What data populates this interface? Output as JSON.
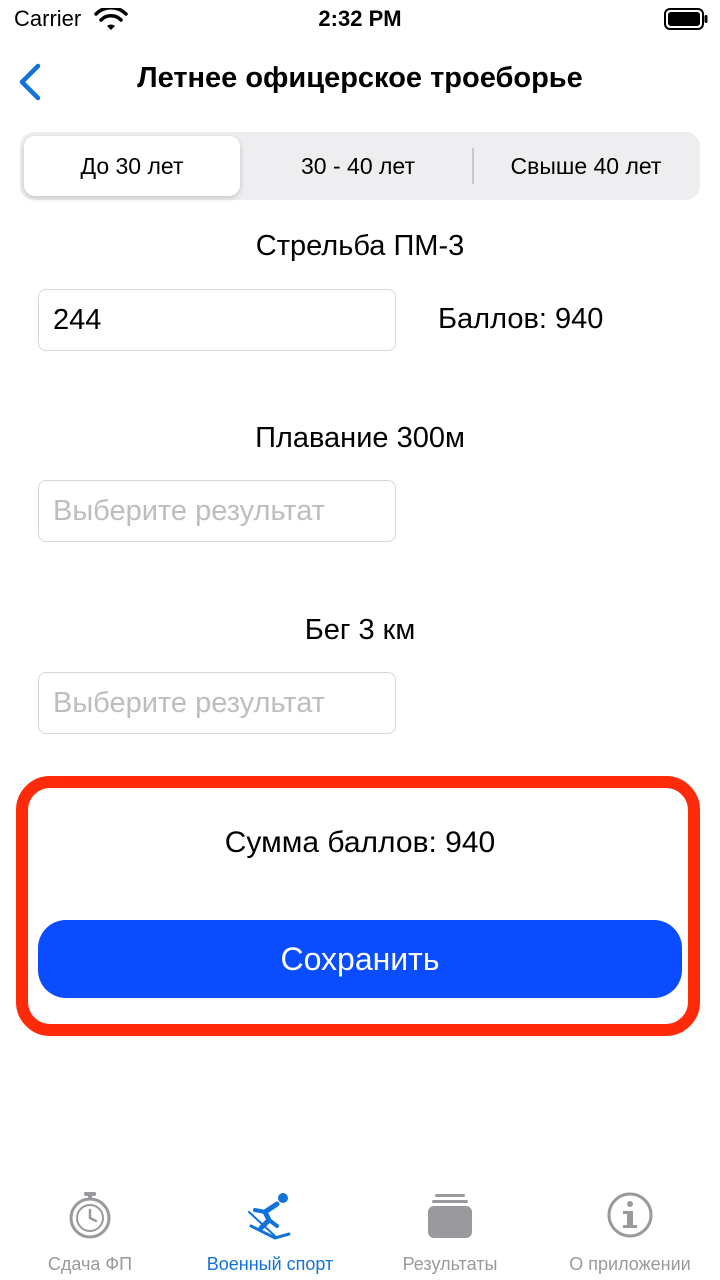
{
  "status_bar": {
    "carrier": "Carrier",
    "time": "2:32 PM"
  },
  "nav": {
    "title": "Летнее офицерское троеборье"
  },
  "segments": [
    {
      "label": "До 30 лет",
      "selected": true
    },
    {
      "label": "30 - 40 лет",
      "selected": false
    },
    {
      "label": "Свыше 40 лет",
      "selected": false
    }
  ],
  "shooting": {
    "label": "Стрельба ПМ-3",
    "value": "244",
    "points": "Баллов: 940"
  },
  "swimming": {
    "label": "Плавание 300м",
    "placeholder": "Выберите результат",
    "value": ""
  },
  "running": {
    "label": "Бег 3 км",
    "placeholder": "Выберите результат",
    "value": ""
  },
  "summary": {
    "total": "Сумма баллов: 940",
    "save_label": "Сохранить",
    "highlight_color": "#ff2a0a"
  },
  "tabs": [
    {
      "label": "Сдача ФП",
      "icon": "stopwatch-icon",
      "active": false
    },
    {
      "label": "Военный спорт",
      "icon": "skier-icon",
      "active": true
    },
    {
      "label": "Результаты",
      "icon": "tray-stack-icon",
      "active": false
    },
    {
      "label": "О приложении",
      "icon": "info-icon",
      "active": false
    }
  ],
  "colors": {
    "accent": "#0a4cff",
    "tab_active": "#1172db",
    "tab_inactive": "#9a9a9e"
  }
}
